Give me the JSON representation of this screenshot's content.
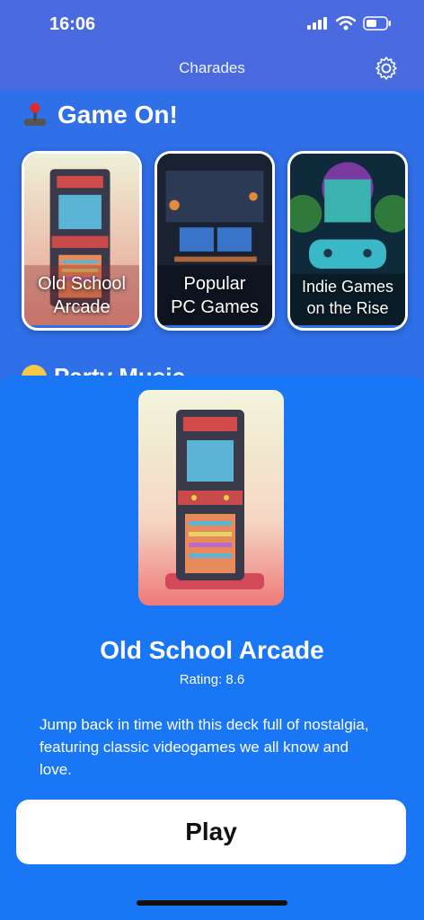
{
  "status": {
    "time": "16:06"
  },
  "nav": {
    "title": "Charades",
    "settings_icon": "gear-icon"
  },
  "section": {
    "title": "Game On!",
    "icon": "joystick-icon"
  },
  "cards": [
    {
      "label": "Old School Arcade",
      "line1": "Old School",
      "line2": "Arcade"
    },
    {
      "label": "Popular PC Games",
      "line1": "Popular",
      "line2": "PC Games"
    },
    {
      "label": "Indie Games on the Rise",
      "line1": "Indie Games",
      "line2": "on the Rise"
    }
  ],
  "next_section": {
    "title": "Party Music"
  },
  "sheet": {
    "title": "Old School Arcade",
    "rating": "Rating: 8.6",
    "description": "Jump back in time with this deck full of nostalgia, featuring classic videogames we all know and love.",
    "play_label": "Play"
  },
  "colors": {
    "background": "#2f6fe8",
    "header": "#4a6be0",
    "sheet": "#1976f5"
  }
}
